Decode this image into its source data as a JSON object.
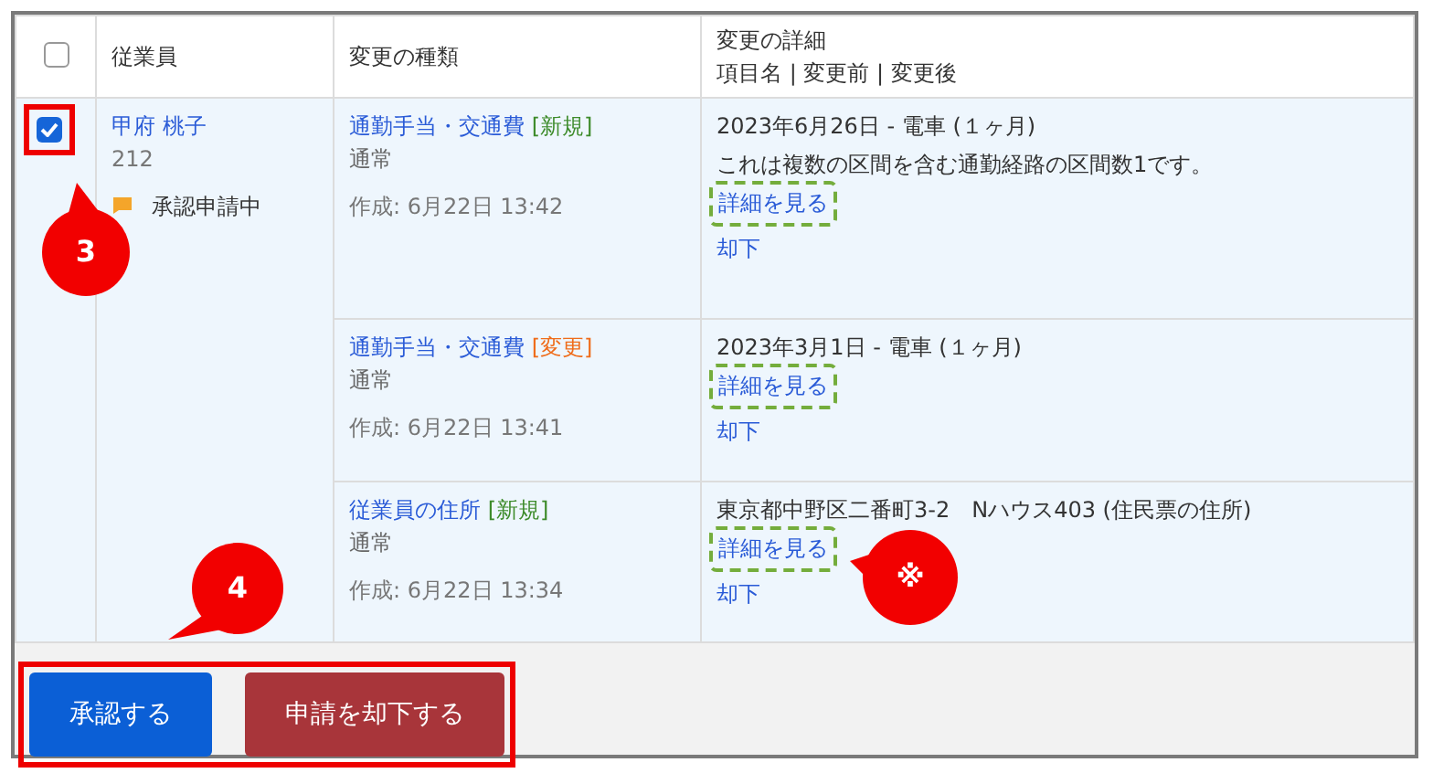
{
  "header": {
    "select_all": {
      "checked": false
    },
    "columns": [
      "従業員",
      "変更の種類"
    ],
    "details_title": "変更の詳細",
    "details_subtitle": "項目名 | 変更前 | 変更後"
  },
  "employee": {
    "checked": true,
    "highlighted": true,
    "name": "甲府 桃子",
    "number": "212",
    "status": "承認申請中"
  },
  "requests": [
    {
      "type": "通勤手当・交通費",
      "tag": {
        "text": "[新規]",
        "color": "#3d8b2a"
      },
      "category": "通常",
      "created": "作成: 6月22日 13:42",
      "detail": "2023年6月26日 - 電車 (１ヶ月)",
      "note": "これは複数の区間を含む通勤経路の区間数1です。",
      "view_link": "詳細を見る",
      "view_highlighted": true,
      "reject_link": "却下"
    },
    {
      "type": "通勤手当・交通費",
      "tag": {
        "text": "[変更]",
        "color": "#ef6c1a"
      },
      "category": "通常",
      "created": "作成: 6月22日 13:41",
      "detail": "2023年3月1日 - 電車 (１ヶ月)",
      "view_link": "詳細を見る",
      "view_highlighted": true,
      "reject_link": "却下"
    },
    {
      "type": "従業員の住所",
      "tag": {
        "text": "[新規]",
        "color": "#3d8b2a"
      },
      "category": "通常",
      "created": "作成: 6月22日 13:34",
      "detail": "東京都中野区二番町3-2　Nハウス403 (住民票の住所)",
      "view_link": "詳細を見る",
      "view_highlighted": true,
      "reject_link": "却下"
    }
  ],
  "actions": {
    "highlighted": true,
    "buttons": [
      {
        "label": "承認する",
        "kind": "primary"
      },
      {
        "label": "申請を却下する",
        "kind": "danger"
      }
    ]
  },
  "callouts": [
    {
      "label": "3"
    },
    {
      "label": "4"
    },
    {
      "label": "※"
    }
  ]
}
